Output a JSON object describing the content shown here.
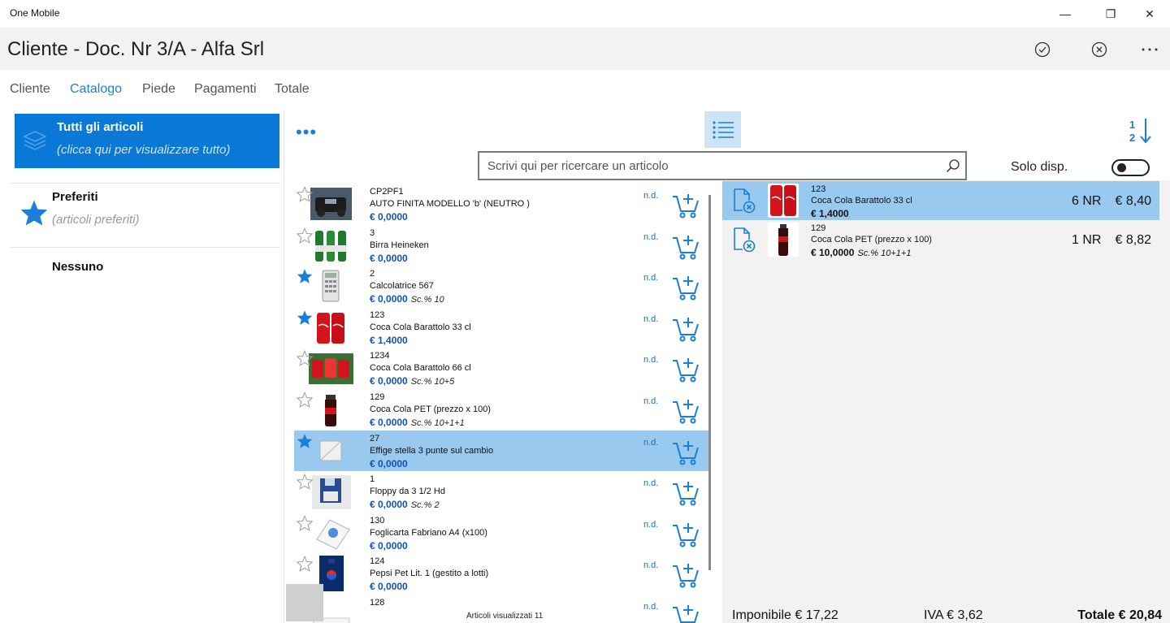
{
  "window": {
    "title": "One Mobile",
    "minimize": "—",
    "restore": "❐",
    "close": "✕"
  },
  "header": {
    "title": "Cliente - Doc. Nr 3/A - Alfa Srl"
  },
  "tabs": [
    "Cliente",
    "Catalogo",
    "Piede",
    "Pagamenti",
    "Totale"
  ],
  "active_tab": "Catalogo",
  "categories": [
    {
      "name": "Tutti gli articoli",
      "desc": "(clicca qui per visualizzare tutto)"
    },
    {
      "name": "Preferiti",
      "desc": "(articoli preferiti)"
    },
    {
      "name": "Nessuno",
      "desc": ""
    }
  ],
  "toolbar": {
    "more": "•••"
  },
  "search": {
    "placeholder": "Scrivi qui per ricercare un articolo"
  },
  "filter": {
    "solo_label": "Solo disp.",
    "solo_on": false
  },
  "articles": [
    {
      "code": "CP2PF1",
      "desc": "AUTO FINITA MODELLO 'b' (NEUTRO )",
      "price": "€ 0,0000",
      "disc": "",
      "avail": "n.d.",
      "fav": false
    },
    {
      "code": "3",
      "desc": "Birra Heineken",
      "price": "€ 0,0000",
      "disc": "",
      "avail": "n.d.",
      "fav": false
    },
    {
      "code": "2",
      "desc": "Calcolatrice 567",
      "price": "€ 0,0000",
      "disc": "Sc.% 10",
      "avail": "n.d.",
      "fav": true
    },
    {
      "code": "123",
      "desc": "Coca Cola Barattolo 33 cl",
      "price": "€ 1,4000",
      "disc": "",
      "avail": "n.d.",
      "fav": true
    },
    {
      "code": "1234",
      "desc": "Coca Cola Barattolo 66 cl",
      "price": "€ 0,0000",
      "disc": "Sc.% 10+5",
      "avail": "n.d.",
      "fav": false
    },
    {
      "code": "129",
      "desc": "Coca Cola PET (prezzo x 100)",
      "price": "€ 0,0000",
      "disc": "Sc.% 10+1+1",
      "avail": "n.d.",
      "fav": false
    },
    {
      "code": "27",
      "desc": "Effige stella 3 punte sul cambio",
      "price": "€ 0,0000",
      "disc": "",
      "avail": "n.d.",
      "fav": true
    },
    {
      "code": "1",
      "desc": "Floppy da 3 1/2 Hd",
      "price": "€ 0,0000",
      "disc": "Sc.% 2",
      "avail": "n.d.",
      "fav": false
    },
    {
      "code": "130",
      "desc": "Foglicarta Fabriano A4 (x100)",
      "price": "€ 0,0000",
      "disc": "",
      "avail": "n.d.",
      "fav": false
    },
    {
      "code": "124",
      "desc": "Pepsi Pet Lit. 1 (gestito a lotti)",
      "price": "€ 0,0000",
      "disc": "",
      "avail": "n.d.",
      "fav": false
    },
    {
      "code": "128",
      "desc": "",
      "price": "",
      "disc": "",
      "avail": "n.d.",
      "fav": false
    }
  ],
  "selected_article": "27",
  "list_footer": "Articoli visualizzati 11",
  "doc_lines": [
    {
      "code": "123",
      "desc": "Coca Cola Barattolo 33 cl",
      "price": "€ 1,4000",
      "disc": "",
      "qty": "6 NR",
      "amount": "€ 8,40"
    },
    {
      "code": "129",
      "desc": "Coca Cola PET (prezzo x 100)",
      "price": "€ 10,0000",
      "disc": "Sc.% 10+1+1",
      "qty": "1 NR",
      "amount": "€ 8,82"
    }
  ],
  "totals": {
    "imponibile": "Imponibile € 17,22",
    "iva": "IVA € 3,62",
    "totale": "Totale € 20,84"
  },
  "colors": {
    "accent": "#0a78d7",
    "selection": "#99c9ee",
    "price": "#1152b0"
  }
}
